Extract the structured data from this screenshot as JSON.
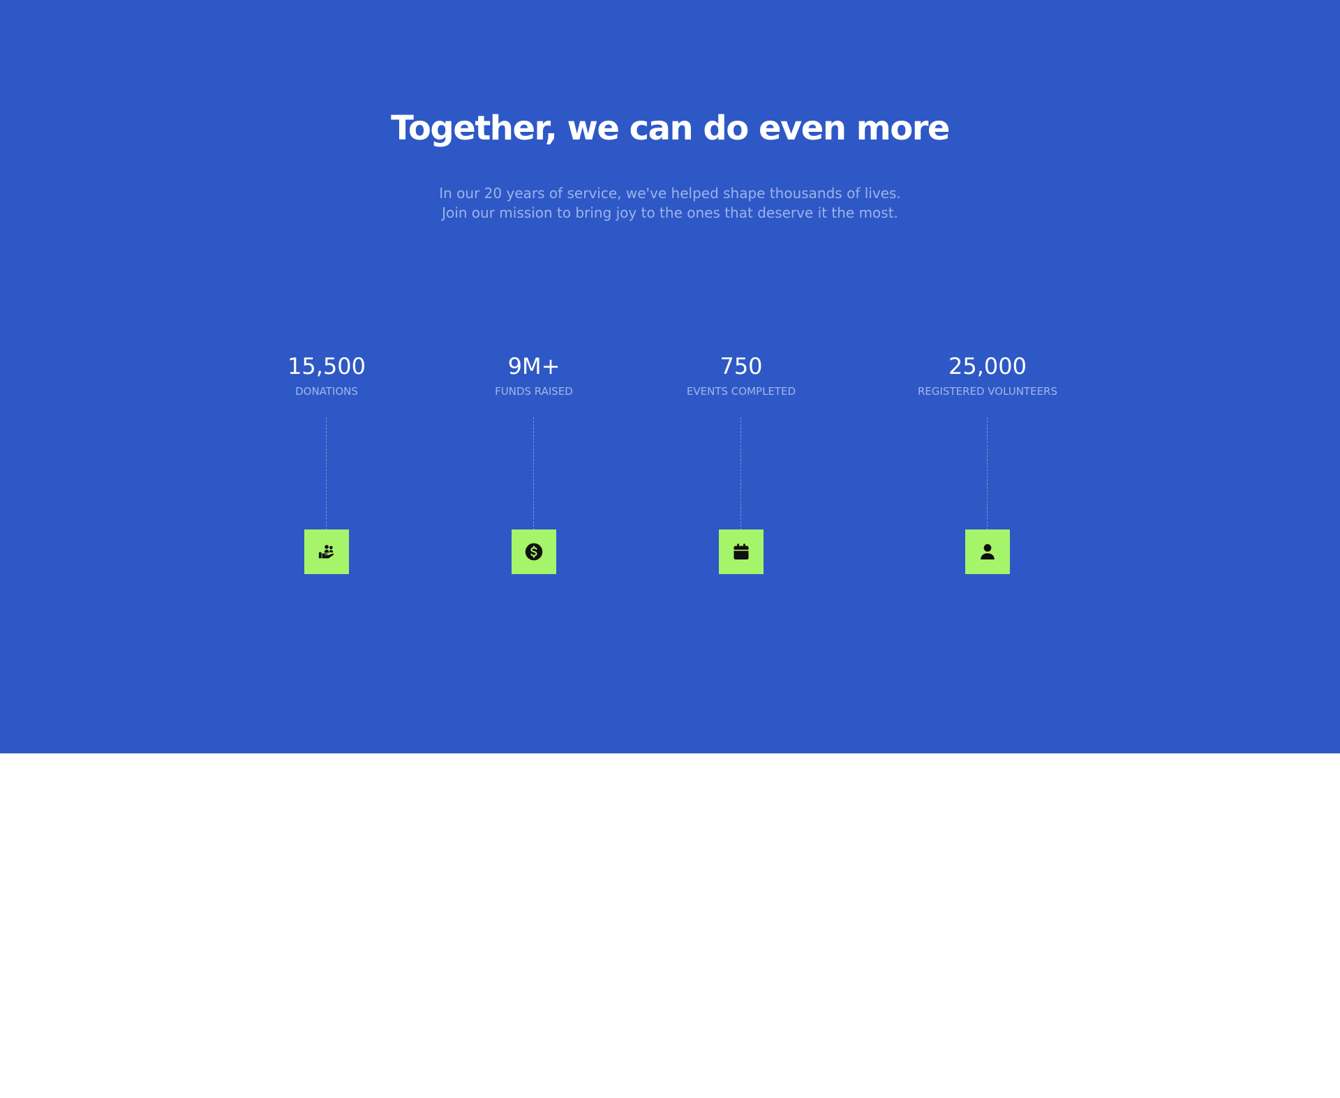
{
  "colors": {
    "background": "#2e58c5",
    "accent": "#a6f46a",
    "icon": "#111111"
  },
  "hero": {
    "headline": "Together, we can do even more",
    "subtitle_lines": [
      "In our 20 years of service, we've helped shape thousands of lives.",
      "Join our mission to bring joy to the ones that deserve it the most."
    ]
  },
  "stats": [
    {
      "value": "15,500",
      "label": "DONATIONS",
      "icon": "hand-holding-people-icon"
    },
    {
      "value": "9M+",
      "label": "FUNDS RAISED",
      "icon": "dollar-circle-icon"
    },
    {
      "value": "750",
      "label": "EVENTS COMPLETED",
      "icon": "calendar-icon"
    },
    {
      "value": "25,000",
      "label": "REGISTERED VOLUNTEERS",
      "icon": "user-icon"
    }
  ]
}
